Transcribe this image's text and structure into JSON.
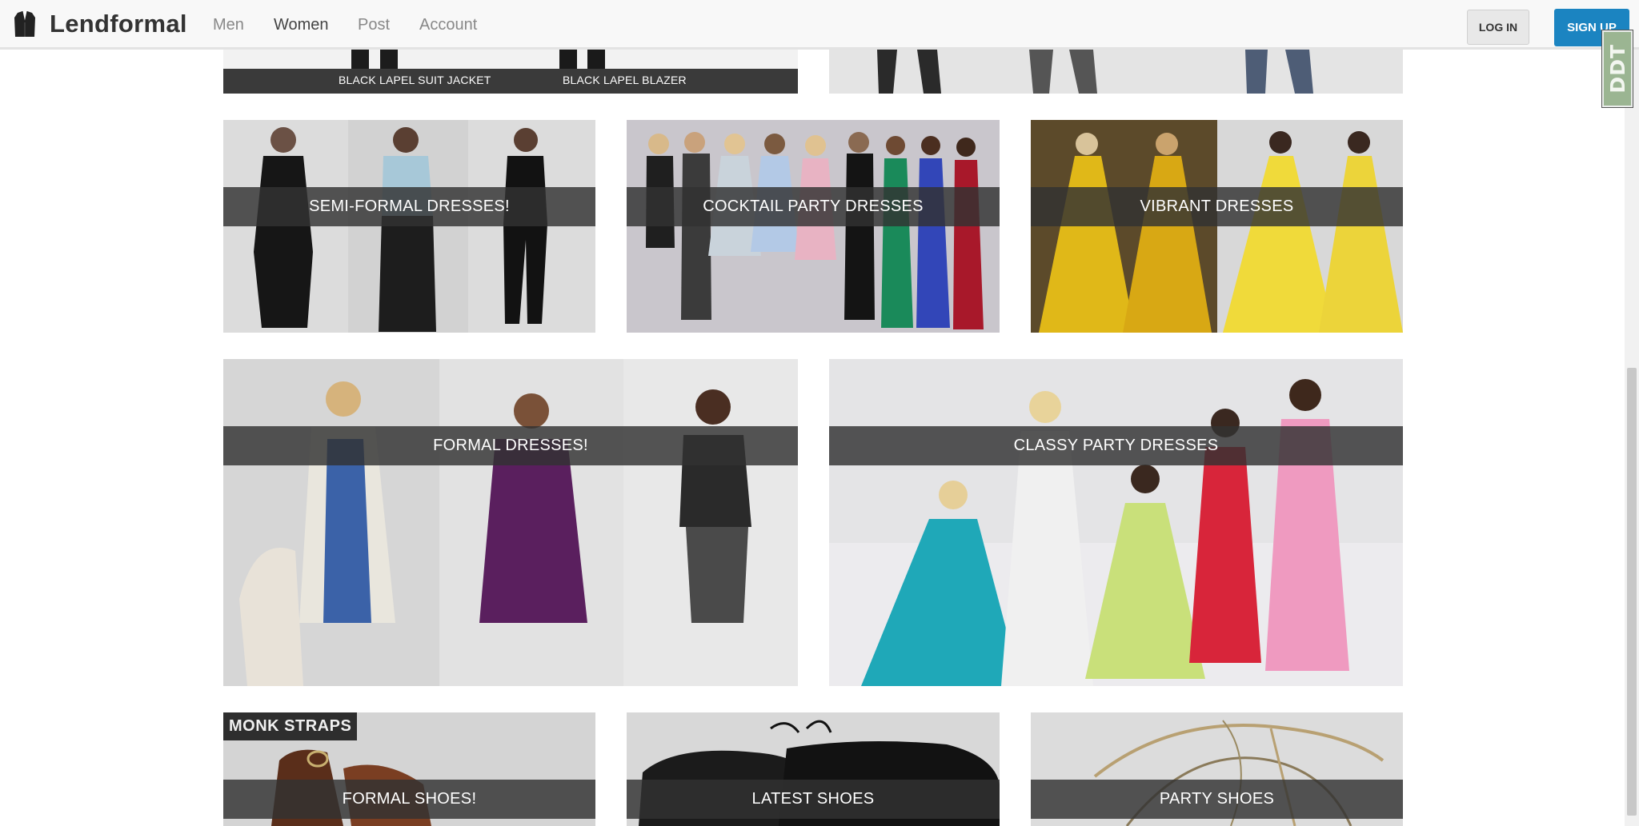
{
  "nav": {
    "brand": "Lendformal",
    "links": [
      "Men",
      "Women",
      "Post",
      "Account"
    ],
    "active": "Women",
    "login": "LOG IN",
    "signup": "SIGN UP"
  },
  "badge": "DDT",
  "top_row": {
    "left_labels": [
      "BLACK LAPEL SUIT JACKET",
      "BLACK LAPEL BLAZER"
    ]
  },
  "tiles": {
    "semi_formal": "SEMI-FORMAL DRESSES!",
    "cocktail": "COCKTAIL PARTY DRESSES",
    "vibrant": "VIBRANT DRESSES",
    "formal": "FORMAL DRESSES!",
    "classy": "CLASSY PARTY DRESSES",
    "formal_shoes": "FORMAL SHOES!",
    "latest_shoes": "LATEST SHOES",
    "party_shoes": "PARTY SHOES",
    "monk_straps": "MONK STRAPS"
  },
  "colors": {
    "accent": "#1b84c1",
    "band": "#323232"
  }
}
